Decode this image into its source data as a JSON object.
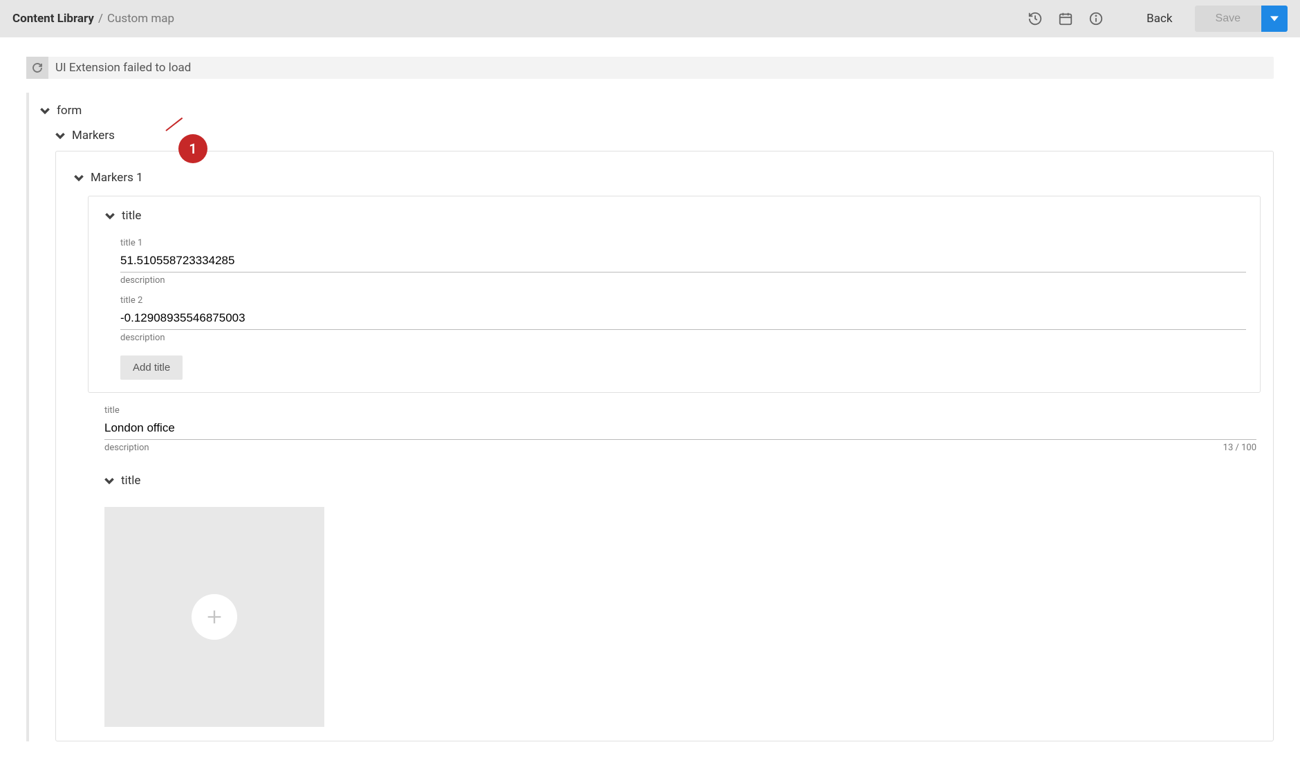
{
  "breadcrumb": {
    "root": "Content Library",
    "sep": "/",
    "current": "Custom map"
  },
  "header": {
    "back": "Back",
    "save": "Save"
  },
  "error": {
    "message": "UI Extension failed to load"
  },
  "callout": {
    "number": "1"
  },
  "tree": {
    "form_label": "form",
    "markers_label": "Markers",
    "markers1_label": "Markers 1",
    "inner_title_label": "title",
    "fields": {
      "title1": {
        "label": "title 1",
        "value": "51.510558723334285",
        "desc": "description"
      },
      "title2": {
        "label": "title 2",
        "value": "-0.12908935546875003",
        "desc": "description"
      }
    },
    "add_title": "Add title",
    "outer_title": {
      "label": "title",
      "value": "London office",
      "desc": "description",
      "count": "13 / 100"
    },
    "lower_title_label": "title"
  }
}
